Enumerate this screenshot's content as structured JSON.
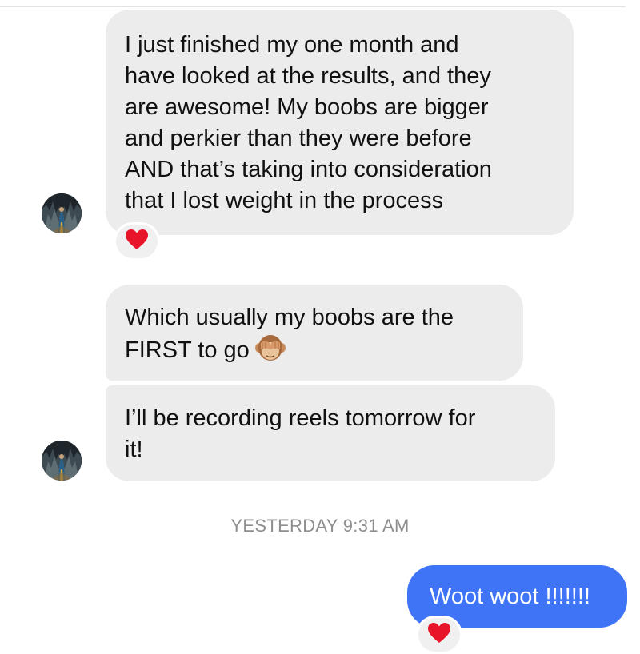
{
  "conversation": {
    "incoming": [
      {
        "text": "I just finished my one month and\nhave looked at the results, and they\nare awesome! My boobs are bigger\nand perkier than they were before\nAND that’s taking into consideration\nthat I lost weight in the process",
        "reaction": "heart-icon"
      },
      {
        "text": "Which usually my boobs are the\nFIRST to go",
        "emoji": "see-no-evil-monkey-icon"
      },
      {
        "text": "I’ll be recording reels tomorrow for\nit!"
      }
    ],
    "timestamp": "YESTERDAY 9:31 AM",
    "outgoing": [
      {
        "text": "Woot woot !!!!!!!",
        "reaction": "heart-icon"
      }
    ]
  },
  "colors": {
    "incoming_bubble": "#ececec",
    "outgoing_bubble": "#3f74f6",
    "timestamp_text": "#8e8e8e",
    "reaction_heart": "#e8152a"
  }
}
